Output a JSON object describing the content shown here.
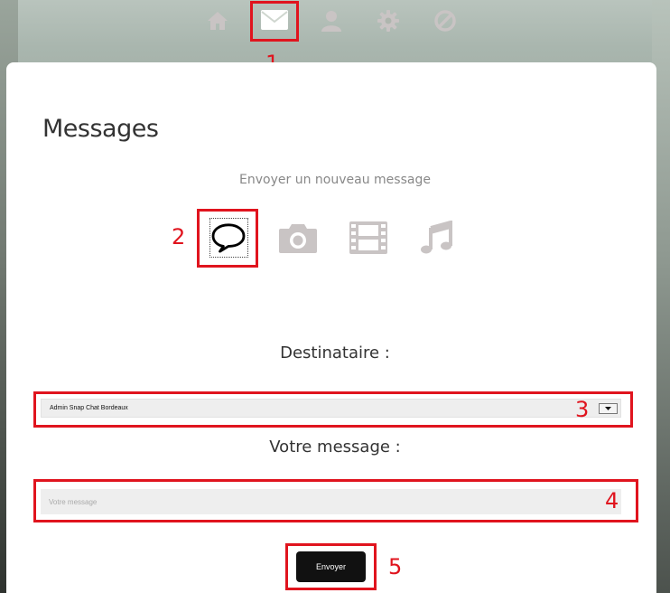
{
  "nav": {
    "items": [
      {
        "name": "home",
        "icon": "home-icon"
      },
      {
        "name": "messages",
        "icon": "mail-icon",
        "active": true
      },
      {
        "name": "profile",
        "icon": "user-icon"
      },
      {
        "name": "settings",
        "icon": "gear-icon"
      },
      {
        "name": "block",
        "icon": "block-icon"
      }
    ]
  },
  "annotations": {
    "n1": "1",
    "n2": "2",
    "n3": "3",
    "n4": "4",
    "n5": "5"
  },
  "page": {
    "title": "Messages",
    "subtitle": "Envoyer un nouveau message"
  },
  "message_types": [
    {
      "name": "text",
      "icon": "speech-bubble-icon",
      "selected": true
    },
    {
      "name": "photo",
      "icon": "camera-icon"
    },
    {
      "name": "video",
      "icon": "film-icon"
    },
    {
      "name": "audio",
      "icon": "music-note-icon"
    }
  ],
  "form": {
    "recipient_label": "Destinataire :",
    "recipient_value": "Admin Snap Chat Bordeaux",
    "message_label": "Votre message :",
    "message_placeholder": "Votre message",
    "send_label": "Envoyer"
  },
  "colors": {
    "annotation_red": "#e0141e",
    "icon_gray": "#c9c4c4",
    "button_bg": "#111111"
  }
}
